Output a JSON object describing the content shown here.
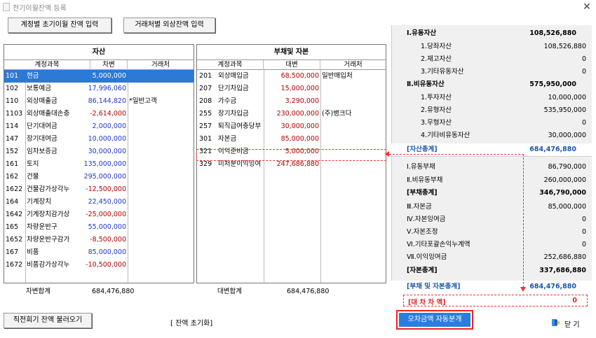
{
  "window": {
    "title": "전기이월잔액 등록",
    "close_glyph": "✕"
  },
  "toolbar": {
    "opening_balance_btn": "계정별 초기이월 잔액 입력",
    "vendor_balance_btn": "거래처별 외상잔액 입력"
  },
  "assets": {
    "title": "자산",
    "headers": [
      "계정과목",
      "차변",
      "거래처"
    ],
    "rows": [
      {
        "code": "101",
        "name": "현금",
        "amount": "5,000,000",
        "partner": ""
      },
      {
        "code": "102",
        "name": "보통예금",
        "amount": "17,996,060",
        "partner": ""
      },
      {
        "code": "110",
        "name": "외상매출금",
        "amount": "86,144,820",
        "partner": "*일반고객"
      },
      {
        "code": "1103",
        "name": "외상매출대손충",
        "amount": "-2,614,000",
        "partner": ""
      },
      {
        "code": "114",
        "name": "단기대여금",
        "amount": "2,000,000",
        "partner": ""
      },
      {
        "code": "147",
        "name": "장기대여금",
        "amount": "10,000,000",
        "partner": ""
      },
      {
        "code": "152",
        "name": "임차보증금",
        "amount": "30,000,000",
        "partner": ""
      },
      {
        "code": "161",
        "name": "토지",
        "amount": "135,000,000",
        "partner": ""
      },
      {
        "code": "162",
        "name": "건물",
        "amount": "295,000,000",
        "partner": ""
      },
      {
        "code": "1622",
        "name": "건물감가상각누",
        "amount": "-12,500,000",
        "partner": ""
      },
      {
        "code": "164",
        "name": "기계장치",
        "amount": "22,450,000",
        "partner": ""
      },
      {
        "code": "1642",
        "name": "기계장치감가상",
        "amount": "-25,000,000",
        "partner": ""
      },
      {
        "code": "165",
        "name": "차량운반구",
        "amount": "55,000,000",
        "partner": ""
      },
      {
        "code": "1652",
        "name": "차량운반구감가",
        "amount": "-8,500,000",
        "partner": ""
      },
      {
        "code": "167",
        "name": "비품",
        "amount": "85,000,000",
        "partner": ""
      },
      {
        "code": "1672",
        "name": "비품감가상각누",
        "amount": "-10,500,000",
        "partner": ""
      }
    ],
    "footer_label": "차변합계",
    "footer_value": "684,476,880"
  },
  "liabilities": {
    "title": "부채및 자본",
    "headers": [
      "계정과목",
      "대변",
      "거래처"
    ],
    "rows": [
      {
        "code": "201",
        "name": "외상매입금",
        "amount": "68,500,000",
        "partner": "일반매입처"
      },
      {
        "code": "207",
        "name": "단기차입금",
        "amount": "15,000,000",
        "partner": ""
      },
      {
        "code": "208",
        "name": "가수금",
        "amount": "3,290,000",
        "partner": ""
      },
      {
        "code": "255",
        "name": "장기차입금",
        "amount": "230,000,000",
        "partner": "(주)뱅크다"
      },
      {
        "code": "257",
        "name": "퇴직급여충당부",
        "amount": "30,000,000",
        "partner": ""
      },
      {
        "code": "301",
        "name": "자본금",
        "amount": "85,000,000",
        "partner": ""
      },
      {
        "code": "321",
        "name": "이익준비금",
        "amount": "5,000,000",
        "partner": ""
      },
      {
        "code": "329",
        "name": "미처분이익잉여",
        "amount": "247,686,880",
        "partner": ""
      }
    ],
    "footer_label": "대변합계",
    "footer_value": "684,476,880"
  },
  "summary": {
    "rows": [
      {
        "label": "Ⅰ.유동자산",
        "value": "108,526,880",
        "kind": "main"
      },
      {
        "label": "1.당좌자산",
        "value": "108,526,880",
        "kind": "sub"
      },
      {
        "label": "2.재고자산",
        "value": "0",
        "kind": "sub"
      },
      {
        "label": "3.기타유동자산",
        "value": "0",
        "kind": "sub"
      },
      {
        "label": "Ⅱ.비유동자산",
        "value": "575,950,000",
        "kind": "main"
      },
      {
        "label": "1.투자자산",
        "value": "10,000,000",
        "kind": "sub"
      },
      {
        "label": "2.유형자산",
        "value": "535,950,000",
        "kind": "sub"
      },
      {
        "label": "3.무형자산",
        "value": "0",
        "kind": "sub"
      },
      {
        "label": "4.기타비유동자산",
        "value": "30,000,000",
        "kind": "sub"
      },
      {
        "label": "[자산총계]",
        "value": "684,476,880",
        "kind": "total"
      },
      {
        "label": "Ⅰ.유동부채",
        "value": "86,790,000",
        "kind": "item"
      },
      {
        "label": "Ⅱ.비유동부채",
        "value": "260,000,000",
        "kind": "item"
      },
      {
        "label": "[부채총계]",
        "value": "346,790,000",
        "kind": "mainitem"
      },
      {
        "label": "Ⅲ.자본금",
        "value": "85,000,000",
        "kind": "item"
      },
      {
        "label": "Ⅳ.자본잉여금",
        "value": "0",
        "kind": "item"
      },
      {
        "label": "Ⅴ.자본조정",
        "value": "0",
        "kind": "item"
      },
      {
        "label": "Ⅵ.기타포괄손익누계액",
        "value": "0",
        "kind": "item"
      },
      {
        "label": "Ⅶ.이익잉여금",
        "value": "252,686,880",
        "kind": "item"
      },
      {
        "label": "[자본총계]",
        "value": "337,686,880",
        "kind": "mainitem"
      },
      {
        "label": "[부채 및 자본총계]",
        "value": "684,476,880",
        "kind": "total"
      }
    ],
    "balance_label": "[대 차 차 액]",
    "balance_value": "0"
  },
  "bottom": {
    "load_prev_btn": "직전회기 잔액 불러오기",
    "reset_link": "[ 잔액 초기화]",
    "auto_split_btn": "오차금액 자동분개",
    "close_btn": "닫 기"
  },
  "colors": {
    "accent_blue": "#2c79d6",
    "highlight_red": "#e33333",
    "negative_red": "#b00000"
  }
}
